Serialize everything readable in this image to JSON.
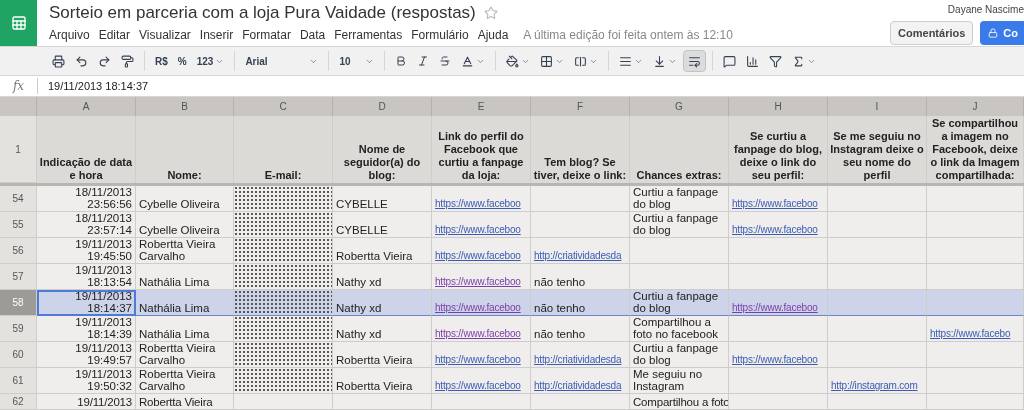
{
  "document": {
    "title": "Sorteio em parceria com a loja Pura Vaidade (respostas)",
    "starred": false,
    "last_edit": "A última edição foi feita ontem às 12:10",
    "user": "Dayane Nascime",
    "comments_button": "Comentários",
    "share_button": "Co"
  },
  "menu": [
    "Arquivo",
    "Editar",
    "Visualizar",
    "Inserir",
    "Formatar",
    "Data",
    "Ferramentas",
    "Formulário",
    "Ajuda"
  ],
  "toolbar": {
    "number_formats": [
      "R$",
      "%",
      "123"
    ],
    "font": "Arial",
    "font_size": "10",
    "wrap_selected": true
  },
  "formula_bar": {
    "label": "fx",
    "value": "19/11/2013 18:14:37"
  },
  "columns": [
    {
      "letter": "A",
      "heading": "Indicação de data e hora"
    },
    {
      "letter": "B",
      "heading": "Nome:"
    },
    {
      "letter": "C",
      "heading": "E-mail:"
    },
    {
      "letter": "D",
      "heading": "Nome de seguidor(a) do blog:"
    },
    {
      "letter": "E",
      "heading": "Link do perfil do Facebook que curtiu a fanpage da loja:"
    },
    {
      "letter": "F",
      "heading": "Tem blog? Se tiver, deixe o link:"
    },
    {
      "letter": "G",
      "heading": "Chances extras:"
    },
    {
      "letter": "H",
      "heading": "Se curtiu a fanpage do blog, deixe o link do seu perfil:"
    },
    {
      "letter": "I",
      "heading": "Se me seguiu no Instagram deixe o seu nome do perfil"
    },
    {
      "letter": "J",
      "heading": "Se compartilhou a imagem no Facebook, deixe o link da Imagem compartilhada:"
    }
  ],
  "header_row_number": "1",
  "rows": [
    {
      "number": "54",
      "selected": false,
      "cells": [
        {
          "kind": "datetime",
          "text": "18/11/2013 23:56:56"
        },
        {
          "kind": "text",
          "text": "Cybelle Oliveira"
        },
        {
          "kind": "redacted"
        },
        {
          "kind": "text",
          "text": "CYBELLE"
        },
        {
          "kind": "link",
          "text": "https://www.faceboo"
        },
        null,
        {
          "kind": "text",
          "text": "Curtiu a fanpage do blog"
        },
        {
          "kind": "link",
          "text": "https://www.faceboo"
        },
        null,
        null
      ]
    },
    {
      "number": "55",
      "selected": false,
      "cells": [
        {
          "kind": "datetime",
          "text": "18/11/2013 23:57:14"
        },
        {
          "kind": "text",
          "text": "Cybelle Oliveira"
        },
        {
          "kind": "redacted"
        },
        {
          "kind": "text",
          "text": "CYBELLE"
        },
        {
          "kind": "link",
          "text": "https://www.faceboo"
        },
        null,
        {
          "kind": "text",
          "text": "Curtiu a fanpage do blog"
        },
        {
          "kind": "link",
          "text": "https://www.faceboo"
        },
        null,
        null
      ]
    },
    {
      "number": "56",
      "selected": false,
      "cells": [
        {
          "kind": "datetime",
          "text": "19/11/2013 19:45:50"
        },
        {
          "kind": "text",
          "text": "Robertta Vieira Carvalho"
        },
        {
          "kind": "redacted"
        },
        {
          "kind": "text",
          "text": "Robertta Vieira"
        },
        {
          "kind": "link",
          "text": "https://www.faceboo"
        },
        {
          "kind": "link",
          "text": "http://criatividadesda"
        },
        null,
        null,
        null,
        null
      ]
    },
    {
      "number": "57",
      "selected": false,
      "cells": [
        {
          "kind": "datetime",
          "text": "19/11/2013 18:13:54"
        },
        {
          "kind": "text",
          "text": "Nathália Lima"
        },
        {
          "kind": "redacted"
        },
        {
          "kind": "text",
          "text": "Nathy xd"
        },
        {
          "kind": "visited_link",
          "text": "https://www.faceboo"
        },
        {
          "kind": "text",
          "text": "não tenho"
        },
        null,
        null,
        null,
        null
      ]
    },
    {
      "number": "58",
      "selected": true,
      "cells": [
        {
          "kind": "datetime",
          "text": "19/11/2013 18:14:37"
        },
        {
          "kind": "text",
          "text": "Nathália Lima"
        },
        {
          "kind": "redacted"
        },
        {
          "kind": "text",
          "text": "Nathy xd"
        },
        {
          "kind": "visited_link",
          "text": "https://www.faceboo"
        },
        {
          "kind": "text",
          "text": "não tenho"
        },
        {
          "kind": "text",
          "text": "Curtiu a fanpage do blog"
        },
        {
          "kind": "visited_link",
          "text": "https://www.faceboo"
        },
        null,
        null
      ]
    },
    {
      "number": "59",
      "selected": false,
      "cells": [
        {
          "kind": "datetime",
          "text": "19/11/2013 18:14:39"
        },
        {
          "kind": "text",
          "text": "Nathália Lima"
        },
        {
          "kind": "redacted"
        },
        {
          "kind": "text",
          "text": "Nathy xd"
        },
        {
          "kind": "visited_link",
          "text": "https://www.faceboo"
        },
        {
          "kind": "text",
          "text": "não tenho"
        },
        {
          "kind": "text",
          "text": "Compartilhou a foto no facebook"
        },
        null,
        null,
        {
          "kind": "link",
          "text": "https://www.facebo"
        }
      ]
    },
    {
      "number": "60",
      "selected": false,
      "cells": [
        {
          "kind": "datetime",
          "text": "19/11/2013 19:49:57"
        },
        {
          "kind": "text",
          "text": "Robertta Vieira Carvalho"
        },
        {
          "kind": "redacted"
        },
        {
          "kind": "text",
          "text": "Robertta Vieira"
        },
        {
          "kind": "link",
          "text": "https://www.faceboo"
        },
        {
          "kind": "link",
          "text": "http://criatividadesda"
        },
        {
          "kind": "text",
          "text": "Curtiu a fanpage do blog"
        },
        {
          "kind": "link",
          "text": "https://www.faceboo"
        },
        null,
        null
      ]
    },
    {
      "number": "61",
      "selected": false,
      "cells": [
        {
          "kind": "datetime",
          "text": "19/11/2013 19:50:32"
        },
        {
          "kind": "text",
          "text": "Robertta Vieira Carvalho"
        },
        {
          "kind": "redacted"
        },
        {
          "kind": "text",
          "text": "Robertta Vieira"
        },
        {
          "kind": "link",
          "text": "https://www.faceboo"
        },
        {
          "kind": "link",
          "text": "http://criatividadesda"
        },
        {
          "kind": "text",
          "text": "Me seguiu no Instagram"
        },
        null,
        {
          "kind": "link",
          "text": "http://instagram.com"
        },
        null
      ]
    },
    {
      "number": "62",
      "selected": false,
      "partial": true,
      "cells": [
        {
          "kind": "datetime",
          "text": "19/11/2013"
        },
        {
          "kind": "text",
          "text": "Robertta Vieira"
        },
        null,
        null,
        null,
        null,
        {
          "kind": "text",
          "text": "Compartilhou a foto"
        },
        null,
        null,
        null
      ]
    }
  ]
}
